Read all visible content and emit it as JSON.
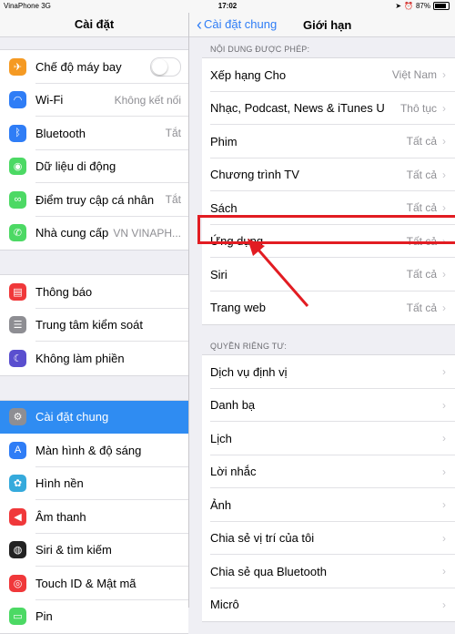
{
  "status_bar": {
    "carrier": "VinaPhone  3G",
    "time": "17:02",
    "battery": "87%",
    "battery_level": 0.87
  },
  "sidebar": {
    "title": "Cài đặt",
    "groups": [
      [
        {
          "label": "Chế độ máy bay",
          "icon": "airplane-icon",
          "color": "#f59a23",
          "toggle": false
        },
        {
          "label": "Wi-Fi",
          "value": "Không kết nối",
          "icon": "wifi-icon",
          "color": "#2f7df6"
        },
        {
          "label": "Bluetooth",
          "value": "Tắt",
          "icon": "bluetooth-icon",
          "color": "#2f7df6"
        },
        {
          "label": "Dữ liệu di động",
          "icon": "cellular-icon",
          "color": "#4cd964"
        },
        {
          "label": "Điểm truy cập cá nhân",
          "value": "Tắt",
          "icon": "hotspot-icon",
          "color": "#4cd964"
        },
        {
          "label": "Nhà cung cấp",
          "value": "VN VINAPH...",
          "icon": "phone-icon",
          "color": "#4cd964"
        }
      ],
      [
        {
          "label": "Thông báo",
          "icon": "notifications-icon",
          "color": "#f0383a"
        },
        {
          "label": "Trung tâm kiểm soát",
          "icon": "control-center-icon",
          "color": "#8e8e93"
        },
        {
          "label": "Không làm phiền",
          "icon": "moon-icon",
          "color": "#5a4fcf"
        }
      ],
      [
        {
          "label": "Cài đặt chung",
          "icon": "gear-icon",
          "color": "#8e8e93",
          "selected": true
        },
        {
          "label": "Màn hình & độ sáng",
          "icon": "display-icon",
          "color": "#2f7df6"
        },
        {
          "label": "Hình nền",
          "icon": "wallpaper-icon",
          "color": "#35aadc"
        },
        {
          "label": "Âm thanh",
          "icon": "sound-icon",
          "color": "#f0383a"
        },
        {
          "label": "Siri & tìm kiếm",
          "icon": "siri-icon",
          "color": "#222222"
        },
        {
          "label": "Touch ID & Mật mã",
          "icon": "fingerprint-icon",
          "color": "#f0383a"
        },
        {
          "label": "Pin",
          "icon": "battery-icon",
          "color": "#4cd964"
        }
      ]
    ]
  },
  "detail": {
    "back_label": "Cài đặt chung",
    "title": "Giới hạn",
    "section1_header": "NỘI DUNG ĐƯỢC PHÉP:",
    "section1": [
      {
        "label": "Xếp hạng Cho",
        "value": "Việt Nam"
      },
      {
        "label": "Nhạc, Podcast, News & iTunes U",
        "value": "Thô tục"
      },
      {
        "label": "Phim",
        "value": "Tất cả"
      },
      {
        "label": "Chương trình TV",
        "value": "Tất cả"
      },
      {
        "label": "Sách",
        "value": "Tất cả"
      },
      {
        "label": "Ứng dụng",
        "value": "Tất cả"
      },
      {
        "label": "Siri",
        "value": "Tất cả"
      },
      {
        "label": "Trang web",
        "value": "Tất cả"
      }
    ],
    "section2_header": "QUYỀN RIÊNG TƯ:",
    "section2": [
      {
        "label": "Dịch vụ định vị"
      },
      {
        "label": "Danh bạ"
      },
      {
        "label": "Lịch"
      },
      {
        "label": "Lời nhắc"
      },
      {
        "label": "Ảnh"
      },
      {
        "label": "Chia sẻ vị trí của tôi"
      },
      {
        "label": "Chia sẻ qua Bluetooth"
      },
      {
        "label": "Micrô"
      }
    ]
  },
  "annotation": {
    "color": "#e21c22"
  }
}
